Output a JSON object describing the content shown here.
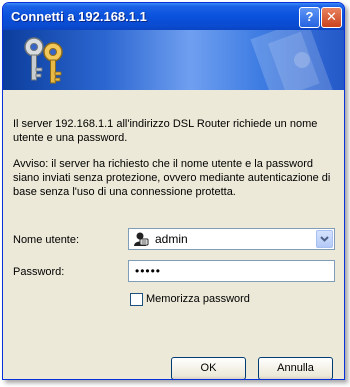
{
  "window": {
    "title": "Connetti a 192.168.1.1",
    "help_label": "?",
    "close_label": "✕"
  },
  "message": {
    "line1": "Il server 192.168.1.1 all'indirizzo DSL Router richiede un nome utente e una password.",
    "line2": "Avviso: il server ha richiesto che il nome utente e la password siano inviati senza protezione, ovvero mediante autenticazione di base senza l'uso di una connessione protetta."
  },
  "form": {
    "username_label": "Nome utente:",
    "username_value": "admin",
    "password_label": "Password:",
    "password_value": "•••••",
    "remember_label": "Memorizza password",
    "remember_checked": false
  },
  "buttons": {
    "ok": "OK",
    "cancel": "Annulla"
  },
  "icons": {
    "banner": "keys-icon",
    "user": "user-icon",
    "dropdown": "chevron-down-icon"
  },
  "colors": {
    "titlebar": "#0a4bd0",
    "dialog_bg": "#ece9d8",
    "banner": "#2c67d1"
  }
}
